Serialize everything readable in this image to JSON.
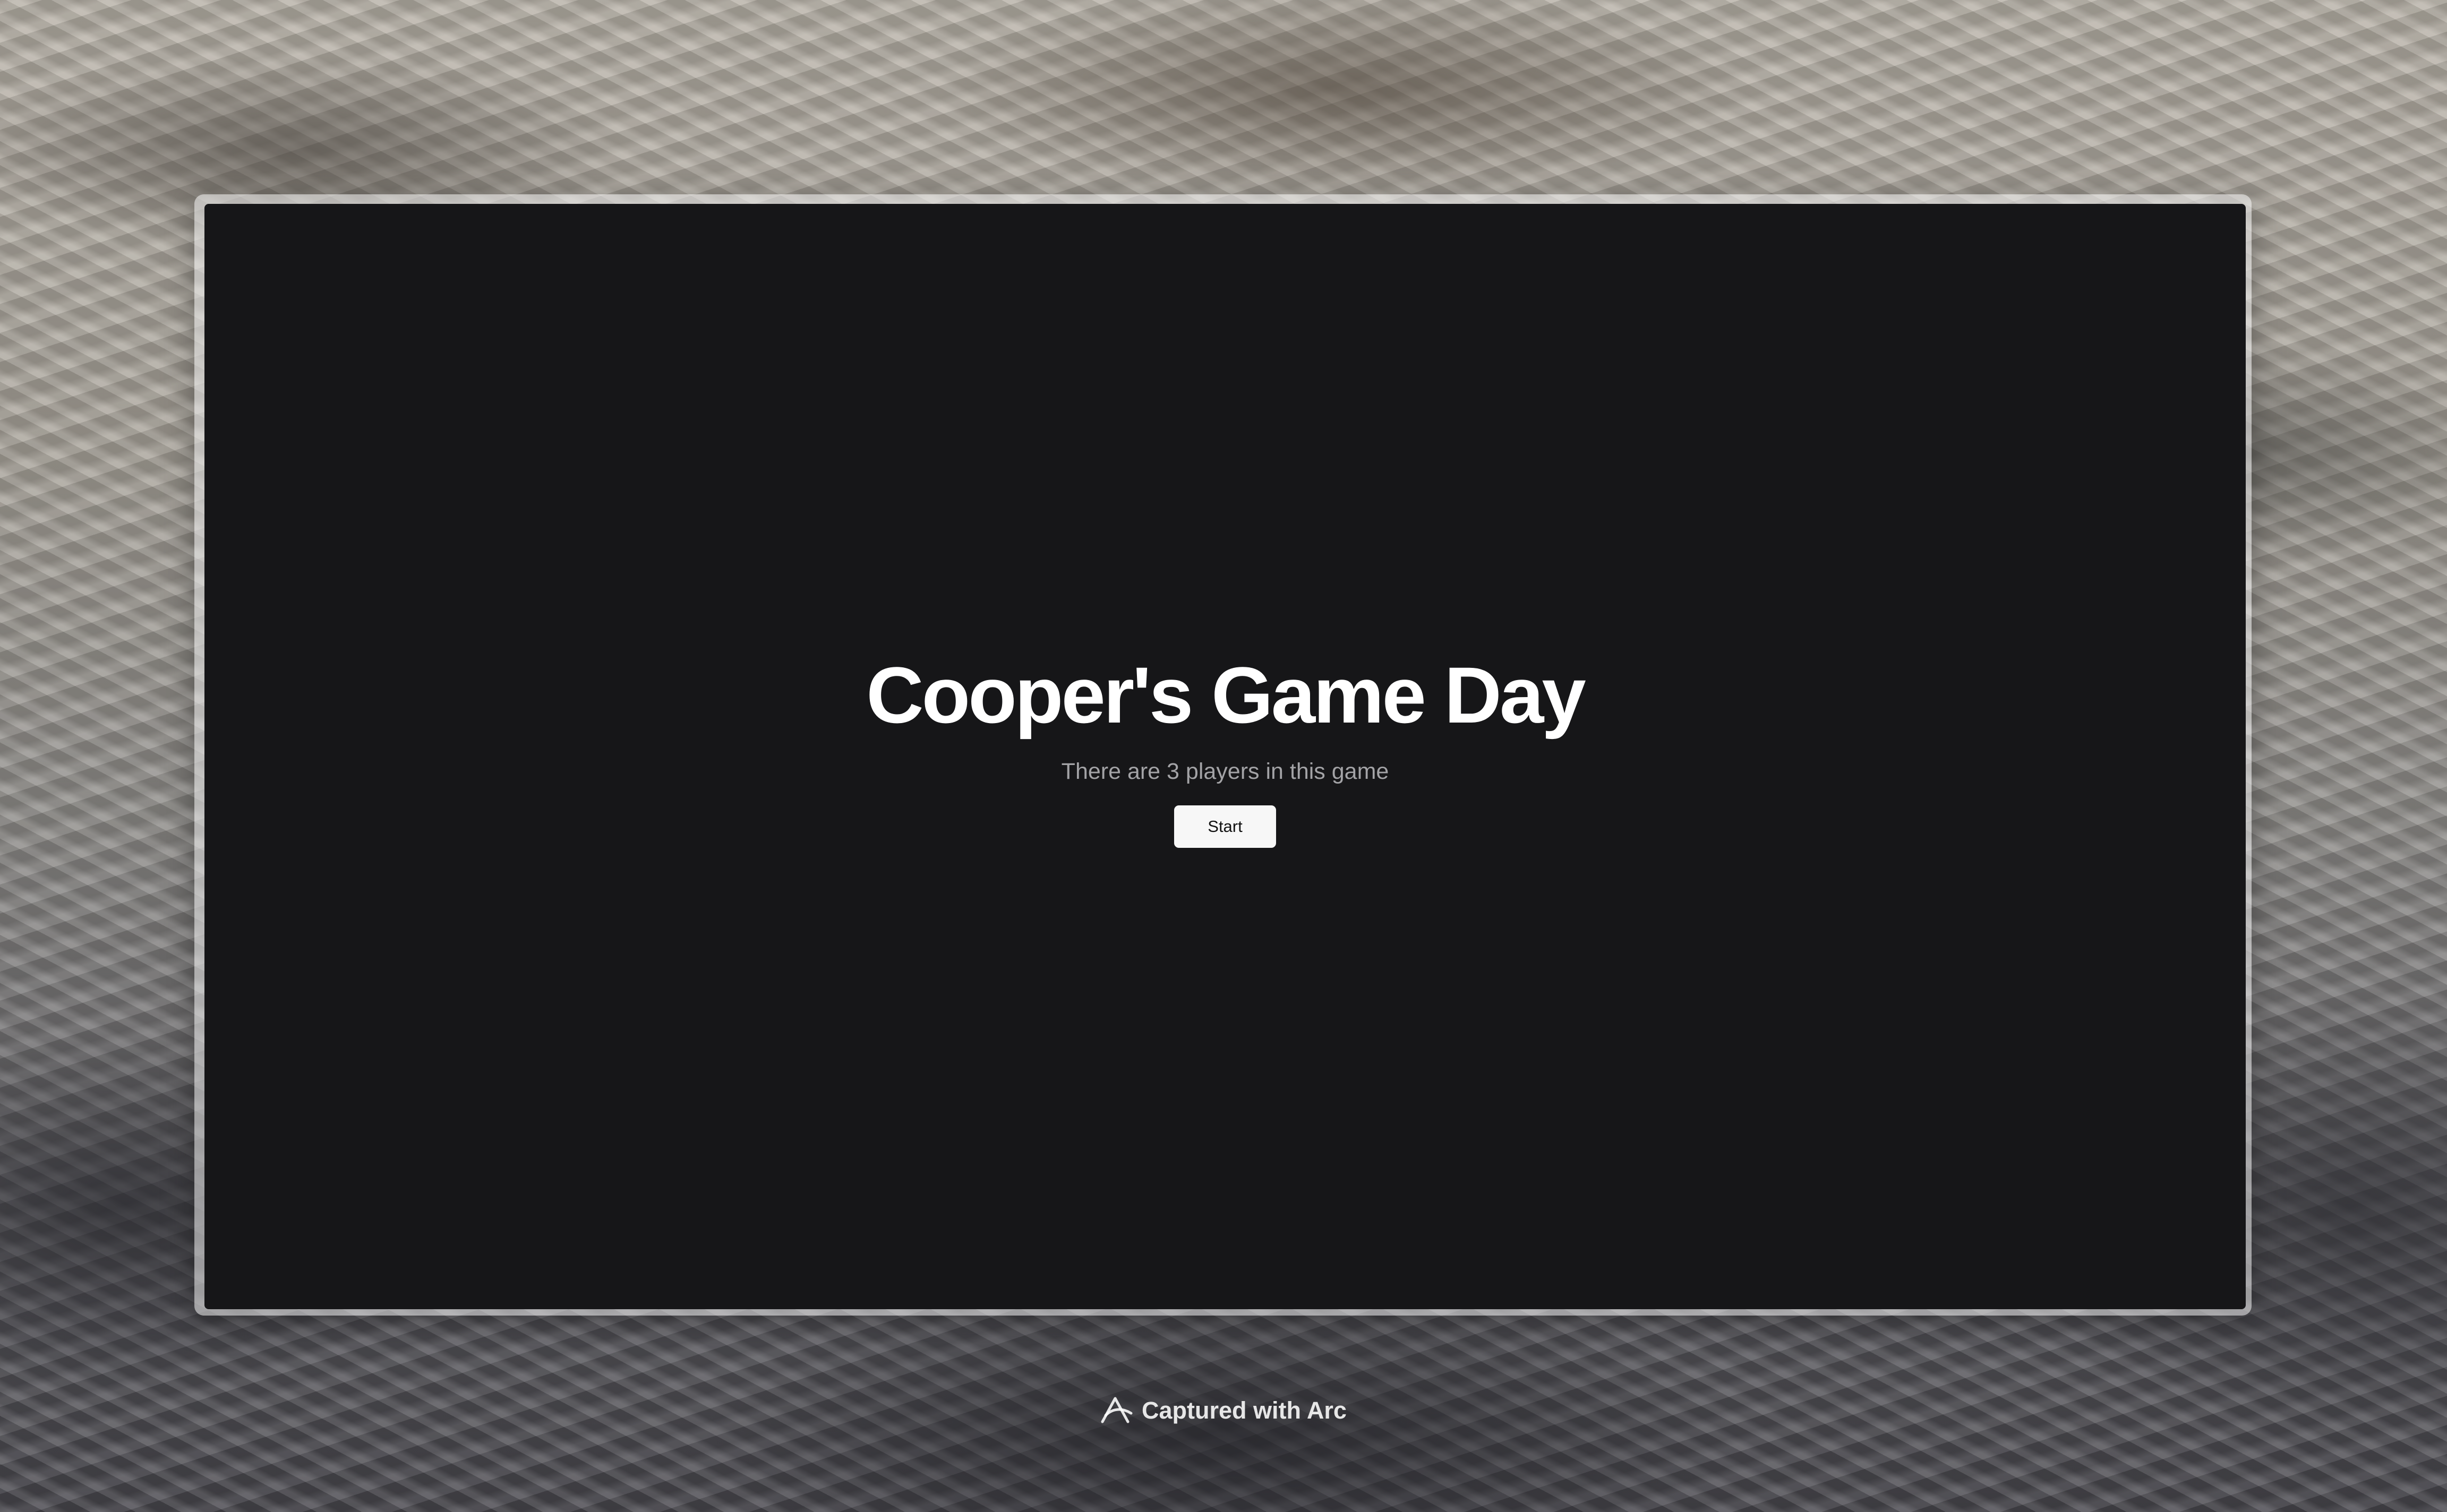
{
  "game": {
    "title": "Cooper's Game Day",
    "subtitle": "There are 3 players in this game",
    "start_label": "Start"
  },
  "watermark": {
    "text": "Captured with Arc",
    "icon": "arc-logo-icon"
  },
  "colors": {
    "window_background": "#161618",
    "title_text": "#ffffff",
    "subtitle_text": "#a3a3a6",
    "button_background": "#f7f7f7",
    "button_text": "#111111"
  }
}
